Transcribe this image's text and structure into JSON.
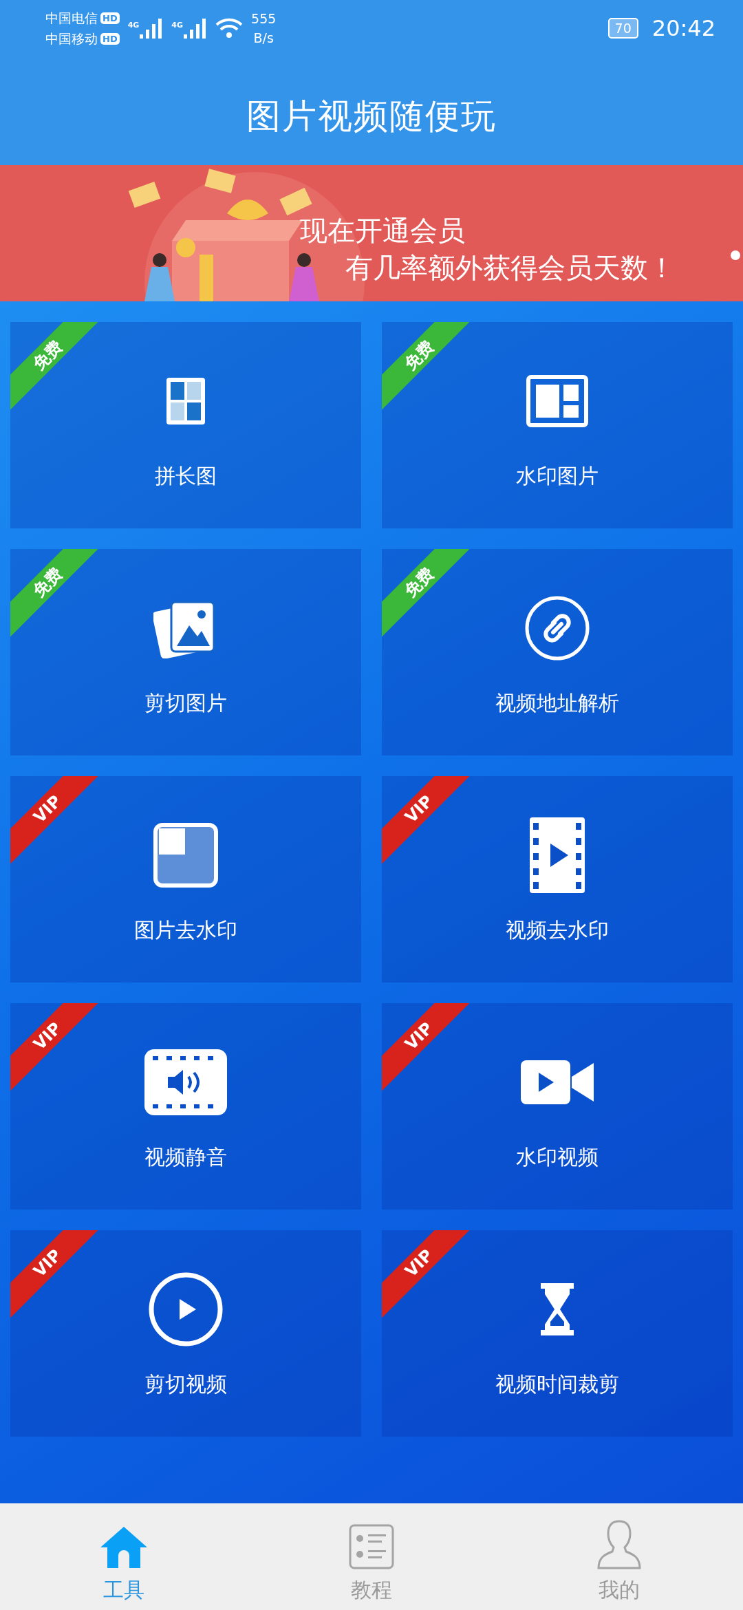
{
  "status_bar": {
    "carriers": [
      "中国电信",
      "中国移动"
    ],
    "hd": [
      "HD",
      "HD"
    ],
    "networks": [
      "4G",
      "4G"
    ],
    "speed": [
      "555",
      "B/s"
    ],
    "battery": "70",
    "time": "20:42"
  },
  "header": {
    "title": "图片视频随便玩"
  },
  "banner": {
    "lines": [
      "现在开通会员",
      "有几率额外获得会员天数！"
    ]
  },
  "tools": [
    {
      "label": "拼长图",
      "kind": "free",
      "badge": "免费"
    },
    {
      "label": "水印图片",
      "kind": "free",
      "badge": "免费"
    },
    {
      "label": "剪切图片",
      "kind": "free",
      "badge": "免费"
    },
    {
      "label": "视频地址解析",
      "kind": "free",
      "badge": "免费"
    },
    {
      "label": "图片去水印",
      "kind": "vip",
      "badge": "VIP"
    },
    {
      "label": "视频去水印",
      "kind": "vip",
      "badge": "VIP"
    },
    {
      "label": "视频静音",
      "kind": "vip",
      "badge": "VIP"
    },
    {
      "label": "水印视频",
      "kind": "vip",
      "badge": "VIP"
    },
    {
      "label": "剪切视频",
      "kind": "vip",
      "badge": "VIP"
    },
    {
      "label": "视频时间裁剪",
      "kind": "vip",
      "badge": "VIP"
    }
  ],
  "tabs": [
    {
      "label": "工具",
      "selected": true
    },
    {
      "label": "教程",
      "selected": false
    },
    {
      "label": "我的",
      "selected": false
    }
  ]
}
